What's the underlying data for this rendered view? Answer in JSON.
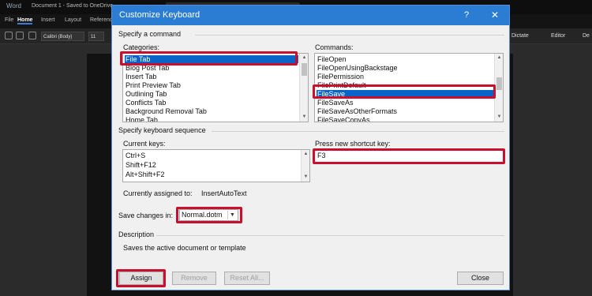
{
  "word": {
    "app_name": "Word",
    "document_title": "Document 1 - Saved to OneDrive",
    "tabs": [
      "File",
      "Home",
      "Insert",
      "Layout",
      "Reference"
    ],
    "font_name": "Calibri (Body)",
    "font_size": "11",
    "dictate_label": "Dictate",
    "editor_label": "Editor",
    "designer_label": "De"
  },
  "dialog": {
    "title": "Customize Keyboard",
    "help_label": "?",
    "close_label": "✕",
    "specify_command": "Specify a command",
    "categories_label": "Categories:",
    "categories": [
      "File Tab",
      "Blog Post Tab",
      "Insert Tab",
      "Print Preview Tab",
      "Outlining Tab",
      "Conflicts Tab",
      "Background Removal Tab",
      "Home Tab"
    ],
    "commands_label": "Commands:",
    "commands": [
      "FileOpen",
      "FileOpenUsingBackstage",
      "FilePermission",
      "FilePrintDefault",
      "FileSave",
      "FileSaveAs",
      "FileSaveAsOtherFormats",
      "FileSaveCopyAs"
    ],
    "specify_sequence": "Specify keyboard sequence",
    "current_keys_label": "Current keys:",
    "current_keys": [
      "Ctrl+S",
      "Shift+F12",
      "Alt+Shift+F2"
    ],
    "new_shortcut_label": "Press new shortcut key:",
    "new_shortcut_value": "F3",
    "assigned_label": "Currently assigned to:",
    "assigned_value": "InsertAutoText",
    "save_changes_label": "Save changes in:",
    "save_changes_value": "Normal.dotm",
    "description_header": "Description",
    "description_text": "Saves the active document or template",
    "assign_label": "Assign",
    "remove_label": "Remove",
    "reset_all_label": "Reset All...",
    "close_label_btn": "Close"
  },
  "colors": {
    "title_bar": "#2b7cd3",
    "selection": "#0a64c8",
    "highlight": "#c8102e"
  }
}
